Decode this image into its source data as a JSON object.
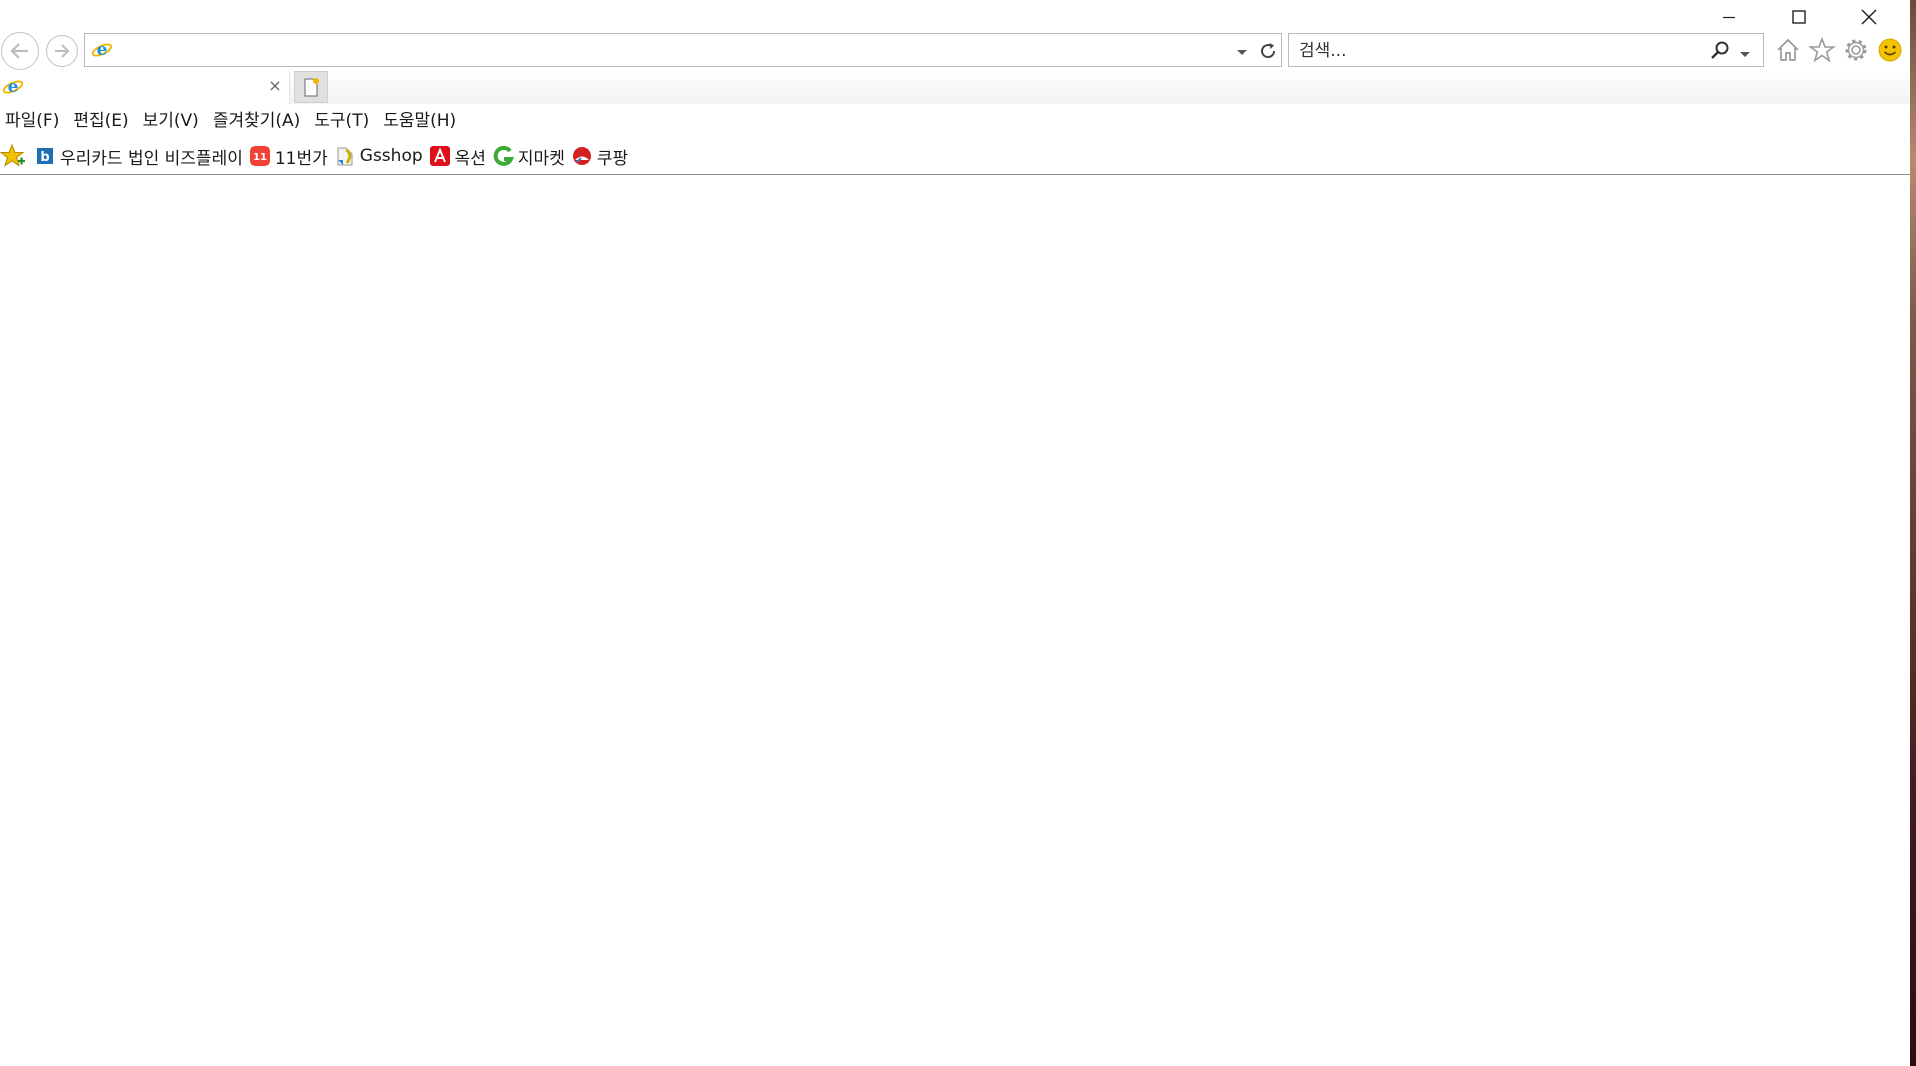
{
  "window": {
    "caption": {
      "minimize": "minimize",
      "maximize": "maximize",
      "close": "close"
    }
  },
  "address": {
    "value": ""
  },
  "search": {
    "placeholder": "검색..."
  },
  "tab": {
    "title": "",
    "close_label": "×"
  },
  "menu": [
    {
      "label": "파일(F)"
    },
    {
      "label": "편집(E)"
    },
    {
      "label": "보기(V)"
    },
    {
      "label": "즐겨찾기(A)"
    },
    {
      "label": "도구(T)"
    },
    {
      "label": "도움말(H)"
    }
  ],
  "favorites": [
    {
      "label": "우리카드 법인 비즈플레이",
      "icon": "bizplay-icon",
      "color": "#1f6fb5"
    },
    {
      "label": "11번가",
      "icon": "11st-icon",
      "color": "#f44336"
    },
    {
      "label": "Gsshop",
      "icon": "gsshop-icon",
      "color": "#c8b400"
    },
    {
      "label": "옥션",
      "icon": "auction-icon",
      "color": "#e0101a"
    },
    {
      "label": "지마켓",
      "icon": "gmarket-icon",
      "color": "#3aaa35"
    },
    {
      "label": "쿠팡",
      "icon": "coupang-icon",
      "color": "#d42020"
    }
  ],
  "colors": {
    "ie_blue": "#1e90d8",
    "ie_ring": "#f4b400",
    "icon_gray": "#8a8a8a",
    "star_yellow": "#f2c200"
  }
}
